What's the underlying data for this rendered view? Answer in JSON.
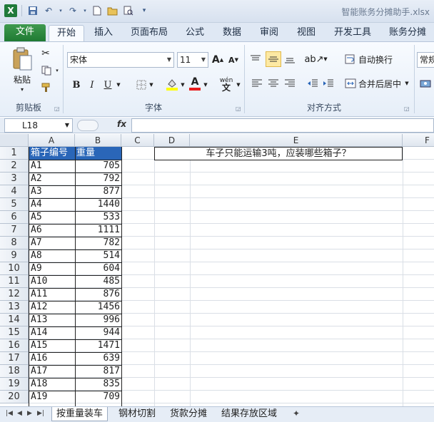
{
  "window": {
    "title": "智能账务分摊助手.xlsx"
  },
  "qat": {
    "icons": [
      "excel-icon",
      "save-icon",
      "undo-icon",
      "redo-icon",
      "new-icon",
      "open-icon",
      "print-preview-icon",
      "customize-icon"
    ]
  },
  "tabs": [
    {
      "label": "文件"
    },
    {
      "label": "开始"
    },
    {
      "label": "插入"
    },
    {
      "label": "页面布局"
    },
    {
      "label": "公式"
    },
    {
      "label": "数据"
    },
    {
      "label": "审阅"
    },
    {
      "label": "视图"
    },
    {
      "label": "开发工具"
    },
    {
      "label": "账务分摊"
    }
  ],
  "ribbon": {
    "clipboard": {
      "label": "剪贴板",
      "paste_label": "粘贴"
    },
    "font": {
      "label": "字体",
      "font_name": "宋体",
      "font_size": "11",
      "bold": "B",
      "italic": "I",
      "underline": "U",
      "grow": "A",
      "shrink": "A",
      "font_color_letter": "A",
      "wen": "wén"
    },
    "alignment": {
      "label": "对齐方式",
      "wrap_text": "自动换行",
      "merge_center": "合并后居中"
    },
    "number": {
      "label": "常规"
    }
  },
  "formula_bar": {
    "name_box": "L18",
    "fx": "fx",
    "formula": ""
  },
  "grid": {
    "columns": [
      "A",
      "B",
      "C",
      "D",
      "E",
      "F"
    ],
    "header_row": {
      "A": "箱子编号",
      "B": "重量"
    },
    "question": "车子只能运输3吨，应装哪些箱子？",
    "rows": [
      {
        "n": "1"
      },
      {
        "n": "2",
        "a": "A1",
        "b": "705"
      },
      {
        "n": "3",
        "a": "A2",
        "b": "792"
      },
      {
        "n": "4",
        "a": "A3",
        "b": "877"
      },
      {
        "n": "5",
        "a": "A4",
        "b": "1440"
      },
      {
        "n": "6",
        "a": "A5",
        "b": "533"
      },
      {
        "n": "7",
        "a": "A6",
        "b": "1111"
      },
      {
        "n": "8",
        "a": "A7",
        "b": "782"
      },
      {
        "n": "9",
        "a": "A8",
        "b": "514"
      },
      {
        "n": "10",
        "a": "A9",
        "b": "604"
      },
      {
        "n": "11",
        "a": "A10",
        "b": "485"
      },
      {
        "n": "12",
        "a": "A11",
        "b": "876"
      },
      {
        "n": "13",
        "a": "A12",
        "b": "1456"
      },
      {
        "n": "14",
        "a": "A13",
        "b": "996"
      },
      {
        "n": "15",
        "a": "A14",
        "b": "944"
      },
      {
        "n": "16",
        "a": "A15",
        "b": "1471"
      },
      {
        "n": "17",
        "a": "A16",
        "b": "639"
      },
      {
        "n": "18",
        "a": "A17",
        "b": "817"
      },
      {
        "n": "19",
        "a": "A18",
        "b": "835"
      },
      {
        "n": "20",
        "a": "A19",
        "b": "709"
      }
    ]
  },
  "sheets": [
    {
      "label": "按重量装车"
    },
    {
      "label": "钢材切割"
    },
    {
      "label": "货款分摊"
    },
    {
      "label": "结果存放区域"
    }
  ],
  "colors": {
    "header_fill": "#2a66b8",
    "file_tab": "#1f7a33"
  }
}
